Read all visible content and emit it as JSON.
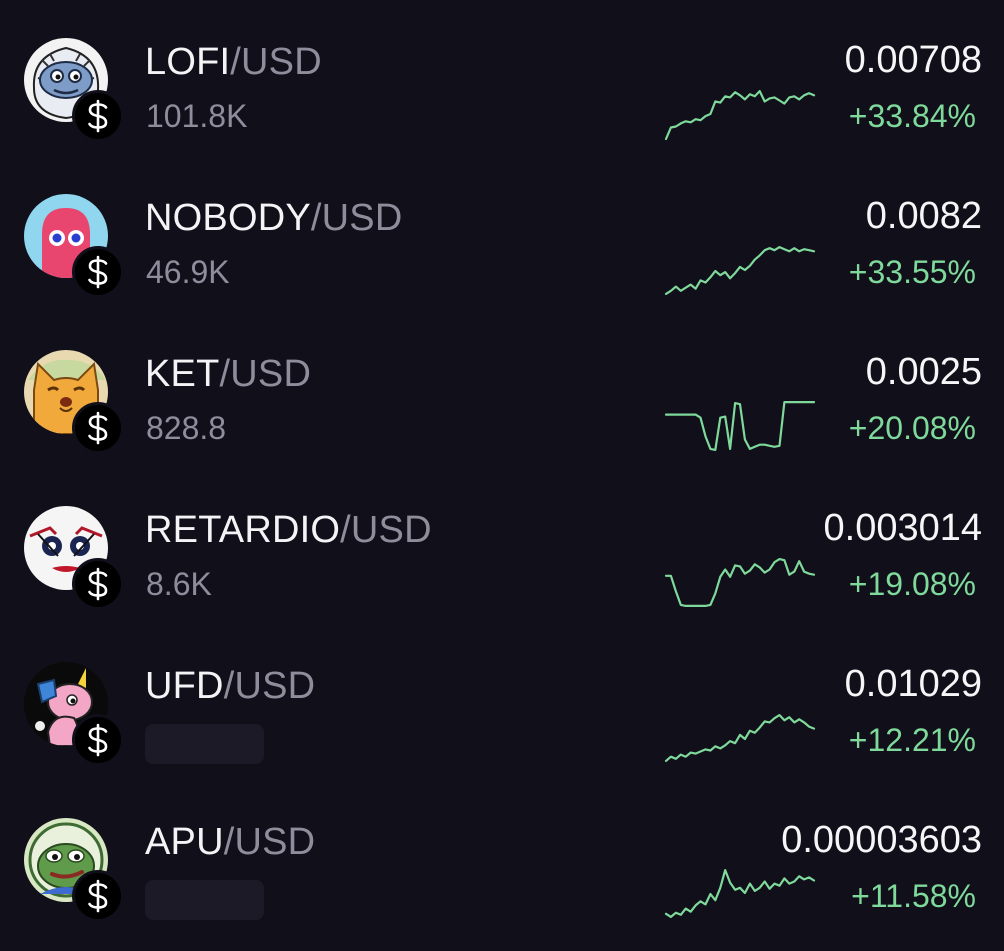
{
  "colors": {
    "background": "#100f1a",
    "positive": "#7fd99a",
    "quote_text": "#8f8d9c",
    "placeholder": "#1b1a26"
  },
  "markets": [
    {
      "base": "LOFI",
      "quote": "/USD",
      "volume": "101.8K",
      "price": "0.00708",
      "change": "+33.84%",
      "avatar_icon": "lofi-yeti-avatar-icon",
      "sparkline": [
        0.02,
        0.24,
        0.26,
        0.32,
        0.36,
        0.34,
        0.4,
        0.38,
        0.46,
        0.5,
        0.74,
        0.72,
        0.84,
        0.82,
        0.92,
        0.86,
        0.78,
        0.88,
        0.84,
        0.94,
        0.74,
        0.8,
        0.82,
        0.76,
        0.7,
        0.82,
        0.84,
        0.78,
        0.86,
        0.9,
        0.86
      ]
    },
    {
      "base": "NOBODY",
      "quote": "/USD",
      "volume": "46.9K",
      "price": "0.0082",
      "change": "+33.55%",
      "avatar_icon": "nobody-ghost-avatar-icon",
      "sparkline": [
        0.04,
        0.1,
        0.18,
        0.1,
        0.16,
        0.22,
        0.14,
        0.3,
        0.26,
        0.36,
        0.48,
        0.4,
        0.46,
        0.34,
        0.44,
        0.56,
        0.5,
        0.58,
        0.7,
        0.78,
        0.88,
        0.92,
        0.88,
        0.94,
        0.9,
        0.86,
        0.92,
        0.86,
        0.9,
        0.88,
        0.86
      ]
    },
    {
      "base": "KET",
      "quote": "/USD",
      "volume": "828.8",
      "price": "0.0025",
      "change": "+20.08%",
      "avatar_icon": "ket-cat-avatar-icon",
      "sparkline": [
        0.72,
        0.72,
        0.72,
        0.72,
        0.72,
        0.72,
        0.72,
        0.66,
        0.3,
        0.06,
        0.04,
        0.66,
        0.68,
        0.06,
        0.94,
        0.92,
        0.24,
        0.06,
        0.1,
        0.14,
        0.14,
        0.12,
        0.1,
        0.12,
        0.96,
        0.96,
        0.96,
        0.96,
        0.96,
        0.96,
        0.96
      ]
    },
    {
      "base": "RETARDIO",
      "quote": "/USD",
      "volume": "8.6K",
      "price": "0.003014",
      "change": "+19.08%",
      "avatar_icon": "retardio-clown-avatar-icon",
      "sparkline": [
        0.62,
        0.62,
        0.32,
        0.06,
        0.04,
        0.04,
        0.04,
        0.04,
        0.04,
        0.06,
        0.28,
        0.6,
        0.74,
        0.6,
        0.82,
        0.8,
        0.66,
        0.72,
        0.84,
        0.78,
        0.68,
        0.74,
        0.88,
        0.94,
        0.92,
        0.64,
        0.7,
        0.9,
        0.7,
        0.66,
        0.64
      ]
    },
    {
      "base": "UFD",
      "quote": "/USD",
      "volume": "",
      "price": "0.01029",
      "change": "+12.21%",
      "avatar_icon": "ufd-unicorn-avatar-icon",
      "sparkline": [
        0.06,
        0.14,
        0.1,
        0.18,
        0.14,
        0.22,
        0.2,
        0.24,
        0.28,
        0.26,
        0.34,
        0.3,
        0.36,
        0.44,
        0.4,
        0.56,
        0.48,
        0.64,
        0.6,
        0.7,
        0.82,
        0.8,
        0.88,
        0.94,
        0.84,
        0.9,
        0.8,
        0.86,
        0.8,
        0.72,
        0.68
      ]
    },
    {
      "base": "APU",
      "quote": "/USD",
      "volume": "",
      "price": "0.00003603",
      "change": "+11.58%",
      "avatar_icon": "apu-frog-avatar-icon",
      "sparkline": [
        0.12,
        0.06,
        0.14,
        0.1,
        0.22,
        0.16,
        0.28,
        0.36,
        0.3,
        0.5,
        0.38,
        0.62,
        0.96,
        0.72,
        0.58,
        0.62,
        0.52,
        0.7,
        0.56,
        0.62,
        0.74,
        0.6,
        0.7,
        0.66,
        0.8,
        0.7,
        0.74,
        0.84,
        0.78,
        0.82,
        0.76
      ]
    }
  ]
}
